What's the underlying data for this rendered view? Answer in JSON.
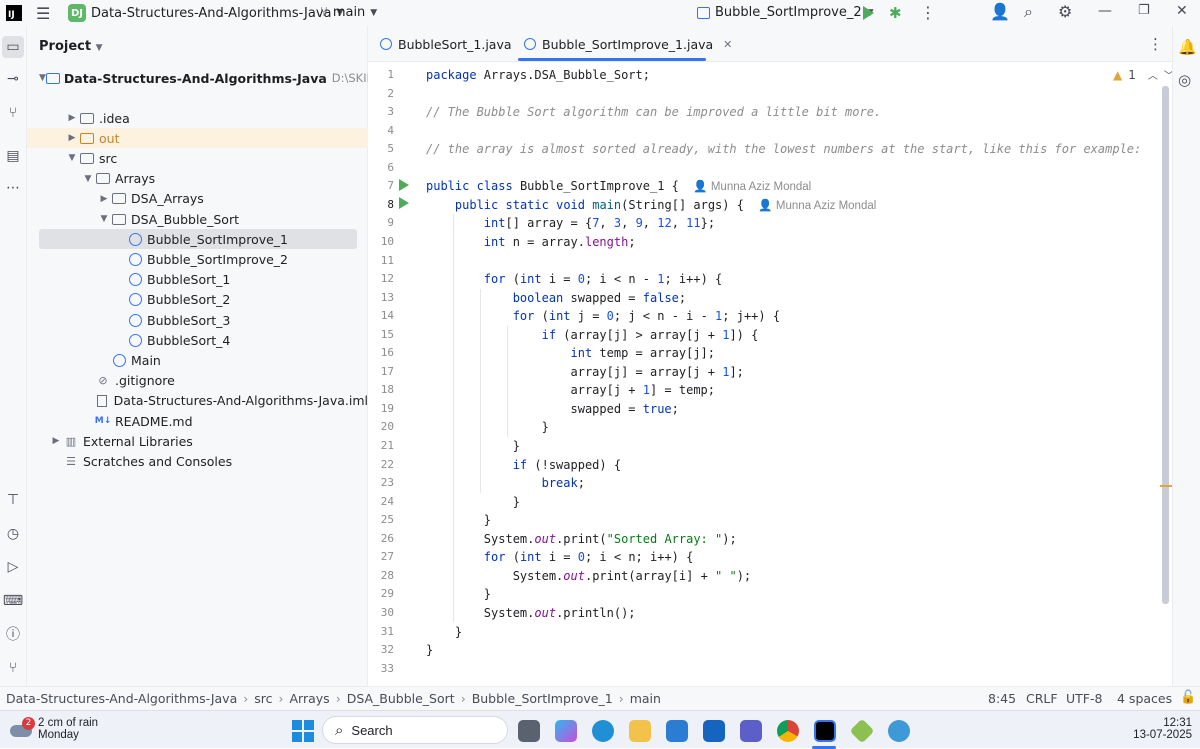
{
  "titlebar": {
    "app_logo": "IJ",
    "project_badge": "DJ",
    "project_name": "Data-Structures-And-Algorithms-Java",
    "branch": "main",
    "run_config": "Bubble_SortImprove_2"
  },
  "project_panel": {
    "title": "Project",
    "root": {
      "name": "Data-Structures-And-Algorithms-Java",
      "path": "D:\\SKILL\\JAVA\\D"
    },
    "items": [
      {
        "label": ".idea",
        "level": 1,
        "type": "folder",
        "expanded": false
      },
      {
        "label": "out",
        "level": 1,
        "type": "folder-orange",
        "expanded": false
      },
      {
        "label": "src",
        "level": 1,
        "type": "folder",
        "expanded": true
      },
      {
        "label": "Arrays",
        "level": 2,
        "type": "package",
        "expanded": true
      },
      {
        "label": "DSA_Arrays",
        "level": 3,
        "type": "package",
        "expanded": false
      },
      {
        "label": "DSA_Bubble_Sort",
        "level": 3,
        "type": "package",
        "expanded": true
      },
      {
        "label": "Bubble_SortImprove_1",
        "level": 4,
        "type": "class",
        "selected": true
      },
      {
        "label": "Bubble_SortImprove_2",
        "level": 4,
        "type": "class"
      },
      {
        "label": "BubbleSort_1",
        "level": 4,
        "type": "class"
      },
      {
        "label": "BubbleSort_2",
        "level": 4,
        "type": "class"
      },
      {
        "label": "BubbleSort_3",
        "level": 4,
        "type": "class"
      },
      {
        "label": "BubbleSort_4",
        "level": 4,
        "type": "class"
      },
      {
        "label": "Main",
        "level": 3,
        "type": "class"
      },
      {
        "label": ".gitignore",
        "level": 2,
        "type": "gitignore"
      },
      {
        "label": "Data-Structures-And-Algorithms-Java.iml",
        "level": 2,
        "type": "file"
      },
      {
        "label": "README.md",
        "level": 2,
        "type": "md"
      },
      {
        "label": "External Libraries",
        "level": 0,
        "type": "lib",
        "expanded": false
      },
      {
        "label": "Scratches and Consoles",
        "level": 0,
        "type": "scratch"
      }
    ]
  },
  "tabs": [
    {
      "label": "BubbleSort_1.java",
      "active": false
    },
    {
      "label": "Bubble_SortImprove_1.java",
      "active": true
    }
  ],
  "editor": {
    "warnings": "1",
    "author": "Munna Aziz Mondal",
    "lines": [
      "package Arrays.DSA_Bubble_Sort;",
      "",
      "// The Bubble Sort algorithm can be improved a little bit more.",
      "",
      "// the array is almost sorted already, with the lowest numbers at the start, like this for example:",
      "",
      "public class Bubble_SortImprove_1 {",
      "    public static void main(String[] args) {",
      "        int[] array = {7, 3, 9, 12, 11};",
      "        int n = array.length;",
      "",
      "        for (int i = 0; i < n - 1; i++) {",
      "            boolean swapped = false;",
      "            for (int j = 0; j < n - i - 1; j++) {",
      "                if (array[j] > array[j + 1]) {",
      "                    int temp = array[j];",
      "                    array[j] = array[j + 1];",
      "                    array[j + 1] = temp;",
      "                    swapped = true;",
      "                }",
      "            }",
      "            if (!swapped) {",
      "                break;",
      "            }",
      "        }",
      "        System.out.print(\"Sorted Array: \");",
      "        for (int i = 0; i < n; i++) {",
      "            System.out.print(array[i] + \" \");",
      "        }",
      "        System.out.println();",
      "    }",
      "}",
      ""
    ]
  },
  "breadcrumb": [
    "Data-Structures-And-Algorithms-Java",
    "src",
    "Arrays",
    "DSA_Bubble_Sort",
    "Bubble_SortImprove_1",
    "main"
  ],
  "status": {
    "position": "8:45",
    "line_sep": "CRLF",
    "encoding": "UTF-8",
    "indent": "4 spaces"
  },
  "taskbar": {
    "weather_badge": "2",
    "weather": "2 cm of rain",
    "weather_sub": "Monday",
    "search": "Search",
    "time": "12:31",
    "date": "13-07-2025"
  }
}
